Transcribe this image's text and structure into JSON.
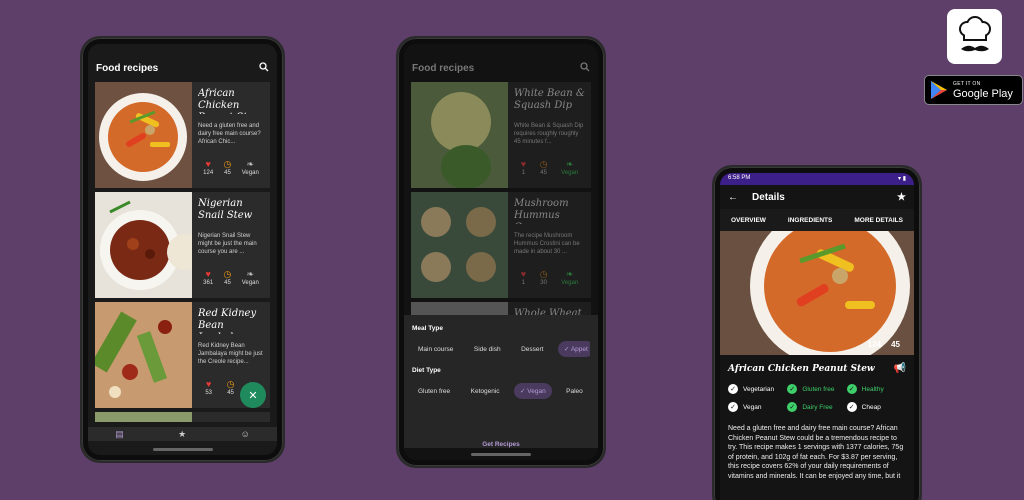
{
  "phone1": {
    "title": "Food recipes",
    "recipes": [
      {
        "title": "African Chicken Peanut Stew",
        "desc": "Need a gluten free and dairy free main course? African Chic...",
        "likes": "124",
        "minutes": "45",
        "vegan": "Vegan"
      },
      {
        "title": "Nigerian Snail Stew",
        "desc": "Nigerian Snail Stew might be just the main course you are ...",
        "likes": "361",
        "minutes": "45",
        "vegan": "Vegan"
      },
      {
        "title": "Red Kidney Bean Jambala...",
        "desc": "Red Kidney Bean Jambalaya might be just the Creole recipe...",
        "likes": "53",
        "minutes": "45",
        "vegan": ""
      }
    ]
  },
  "phone2": {
    "title": "Food recipes",
    "recipes": [
      {
        "title": "White Bean & Squash Dip",
        "desc": "White Bean & Squash Dip requires roughly roughly 45 minutes f...",
        "likes": "1",
        "minutes": "45",
        "vegan": "Vegan"
      },
      {
        "title": "Mushroom Hummus Cros...",
        "desc": "The recipe Mushroom Hummus Crostini can be made in about 30 ...",
        "likes": "1",
        "minutes": "30",
        "vegan": "Vegan"
      },
      {
        "title": "Whole Wheat",
        "desc": "",
        "likes": "",
        "minutes": "",
        "vegan": ""
      }
    ],
    "meal_type_label": "Meal Type",
    "meal_types": [
      "Main course",
      "Side dish",
      "Dessert",
      "Appet"
    ],
    "diet_type_label": "Diet Type",
    "diet_types": [
      "Gluten free",
      "Ketogenic",
      "Vegan",
      "Paleo"
    ],
    "get_recipes": "Get Recipes"
  },
  "phone3": {
    "time": "6:58 PM",
    "title": "Details",
    "tabs": [
      "OVERVIEW",
      "INGREDIENTS",
      "MORE DETAILS"
    ],
    "likes": "124",
    "minutes": "45",
    "recipe_title": "African Chicken Peanut Stew",
    "checks": [
      {
        "label": "Vegetarian",
        "color": "#ffffff"
      },
      {
        "label": "Gluten free",
        "color": "#3ecf6a"
      },
      {
        "label": "Healthy",
        "color": "#3ecf6a"
      },
      {
        "label": "Vegan",
        "color": "#ffffff"
      },
      {
        "label": "Dairy Free",
        "color": "#3ecf6a"
      },
      {
        "label": "Cheap",
        "color": "#ffffff"
      }
    ],
    "summary": "Need a gluten free and dairy free main course? African Chicken Peanut Stew could be a tremendous recipe to try. This recipe makes 1 servings with 1377 calories, 75g of protein, and 102g of fat each. For $3.87 per serving, this recipe covers 62% of your daily requirements of vitamins and minerals. It can be enjoyed any time, but it"
  },
  "store": {
    "get_it_on": "GET IT ON",
    "google_play": "Google Play"
  },
  "colors": {
    "accent": "#b59bd6",
    "heart": "#e53935",
    "clock": "#f39c12",
    "leaf": "#3ecf6a",
    "background": "#5d3f6a"
  }
}
